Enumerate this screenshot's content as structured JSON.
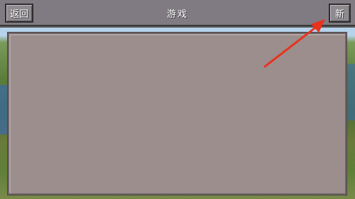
{
  "header": {
    "title": "游戏",
    "back_label": "返回",
    "new_label": "新"
  },
  "colors": {
    "annotation_arrow": "#e8321e"
  }
}
